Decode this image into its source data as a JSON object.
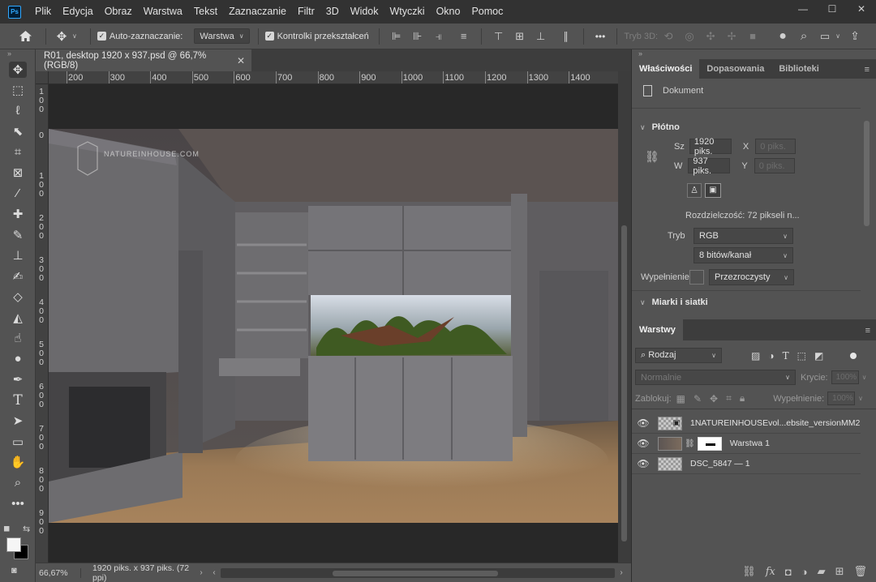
{
  "app": {
    "logo": "Ps"
  },
  "menu": [
    "Plik",
    "Edycja",
    "Obraz",
    "Warstwa",
    "Tekst",
    "Zaznaczanie",
    "Filtr",
    "3D",
    "Widok",
    "Wtyczki",
    "Okno",
    "Pomoc"
  ],
  "window_controls": {
    "minimize": "—",
    "maximize": "☐",
    "close": "✕"
  },
  "options": {
    "auto_select_label": "Auto-zaznaczanie:",
    "auto_select_target": "Warstwa",
    "transform_controls_label": "Kontrolki przekształceń",
    "more": "•••",
    "mode_3d_label": "Tryb 3D:"
  },
  "document": {
    "tab_title": "R01, desktop 1920 x 937.psd @ 66,7% (RGB/8)",
    "close": "✕",
    "watermark": "NATUREINHOUSE.COM"
  },
  "ruler": {
    "h_labels": [
      "200",
      "300",
      "400",
      "500",
      "600",
      "700",
      "800",
      "900",
      "1000",
      "1100",
      "1200",
      "1300",
      "1400"
    ],
    "v_labels": [
      "1\n0\n0",
      "0",
      "1\n0\n0",
      "2\n0\n0",
      "3\n0\n0",
      "4\n0\n0",
      "5\n0\n0",
      "6\n0\n0",
      "7\n0\n0",
      "8\n0\n0",
      "9\n0\n0"
    ]
  },
  "status": {
    "zoom": "66,67%",
    "info": "1920 piks. x 937 piks. (72 ppi)",
    "expand_arrow": "›",
    "scroll_left": "‹",
    "scroll_right": "›"
  },
  "properties_panel": {
    "tabs": [
      "Właściwości",
      "Dopasowania",
      "Biblioteki"
    ],
    "doc_label": "Dokument",
    "canvas_section": "Płótno",
    "width_label": "Sz",
    "width_value": "1920 piks.",
    "height_label": "W",
    "height_value": "937 piks.",
    "x_label": "X",
    "x_placeholder": "0 piks.",
    "y_label": "Y",
    "y_placeholder": "0 piks.",
    "resolution": "Rozdzielczość: 72 pikseli n...",
    "mode_label": "Tryb",
    "mode_value": "RGB",
    "bits_value": "8 bitów/kanał",
    "fill_label": "Wypełnienie",
    "fill_value": "Przezroczysty",
    "rulers_section": "Miarki i siatki"
  },
  "layers_panel": {
    "tab": "Warstwy",
    "filter_kind": "Rodzaj",
    "blend_mode": "Normalnie",
    "opacity_label": "Krycie:",
    "opacity_value": "100%",
    "lock_label": "Zablokuj:",
    "fill_label": "Wypełnienie:",
    "fill_value": "100%",
    "layers": [
      {
        "name": "1NATUREINHOUSEvol...ebsite_versionMM2"
      },
      {
        "name": "Warstwa 1"
      },
      {
        "name": "DSC_5847 — 1"
      }
    ]
  }
}
